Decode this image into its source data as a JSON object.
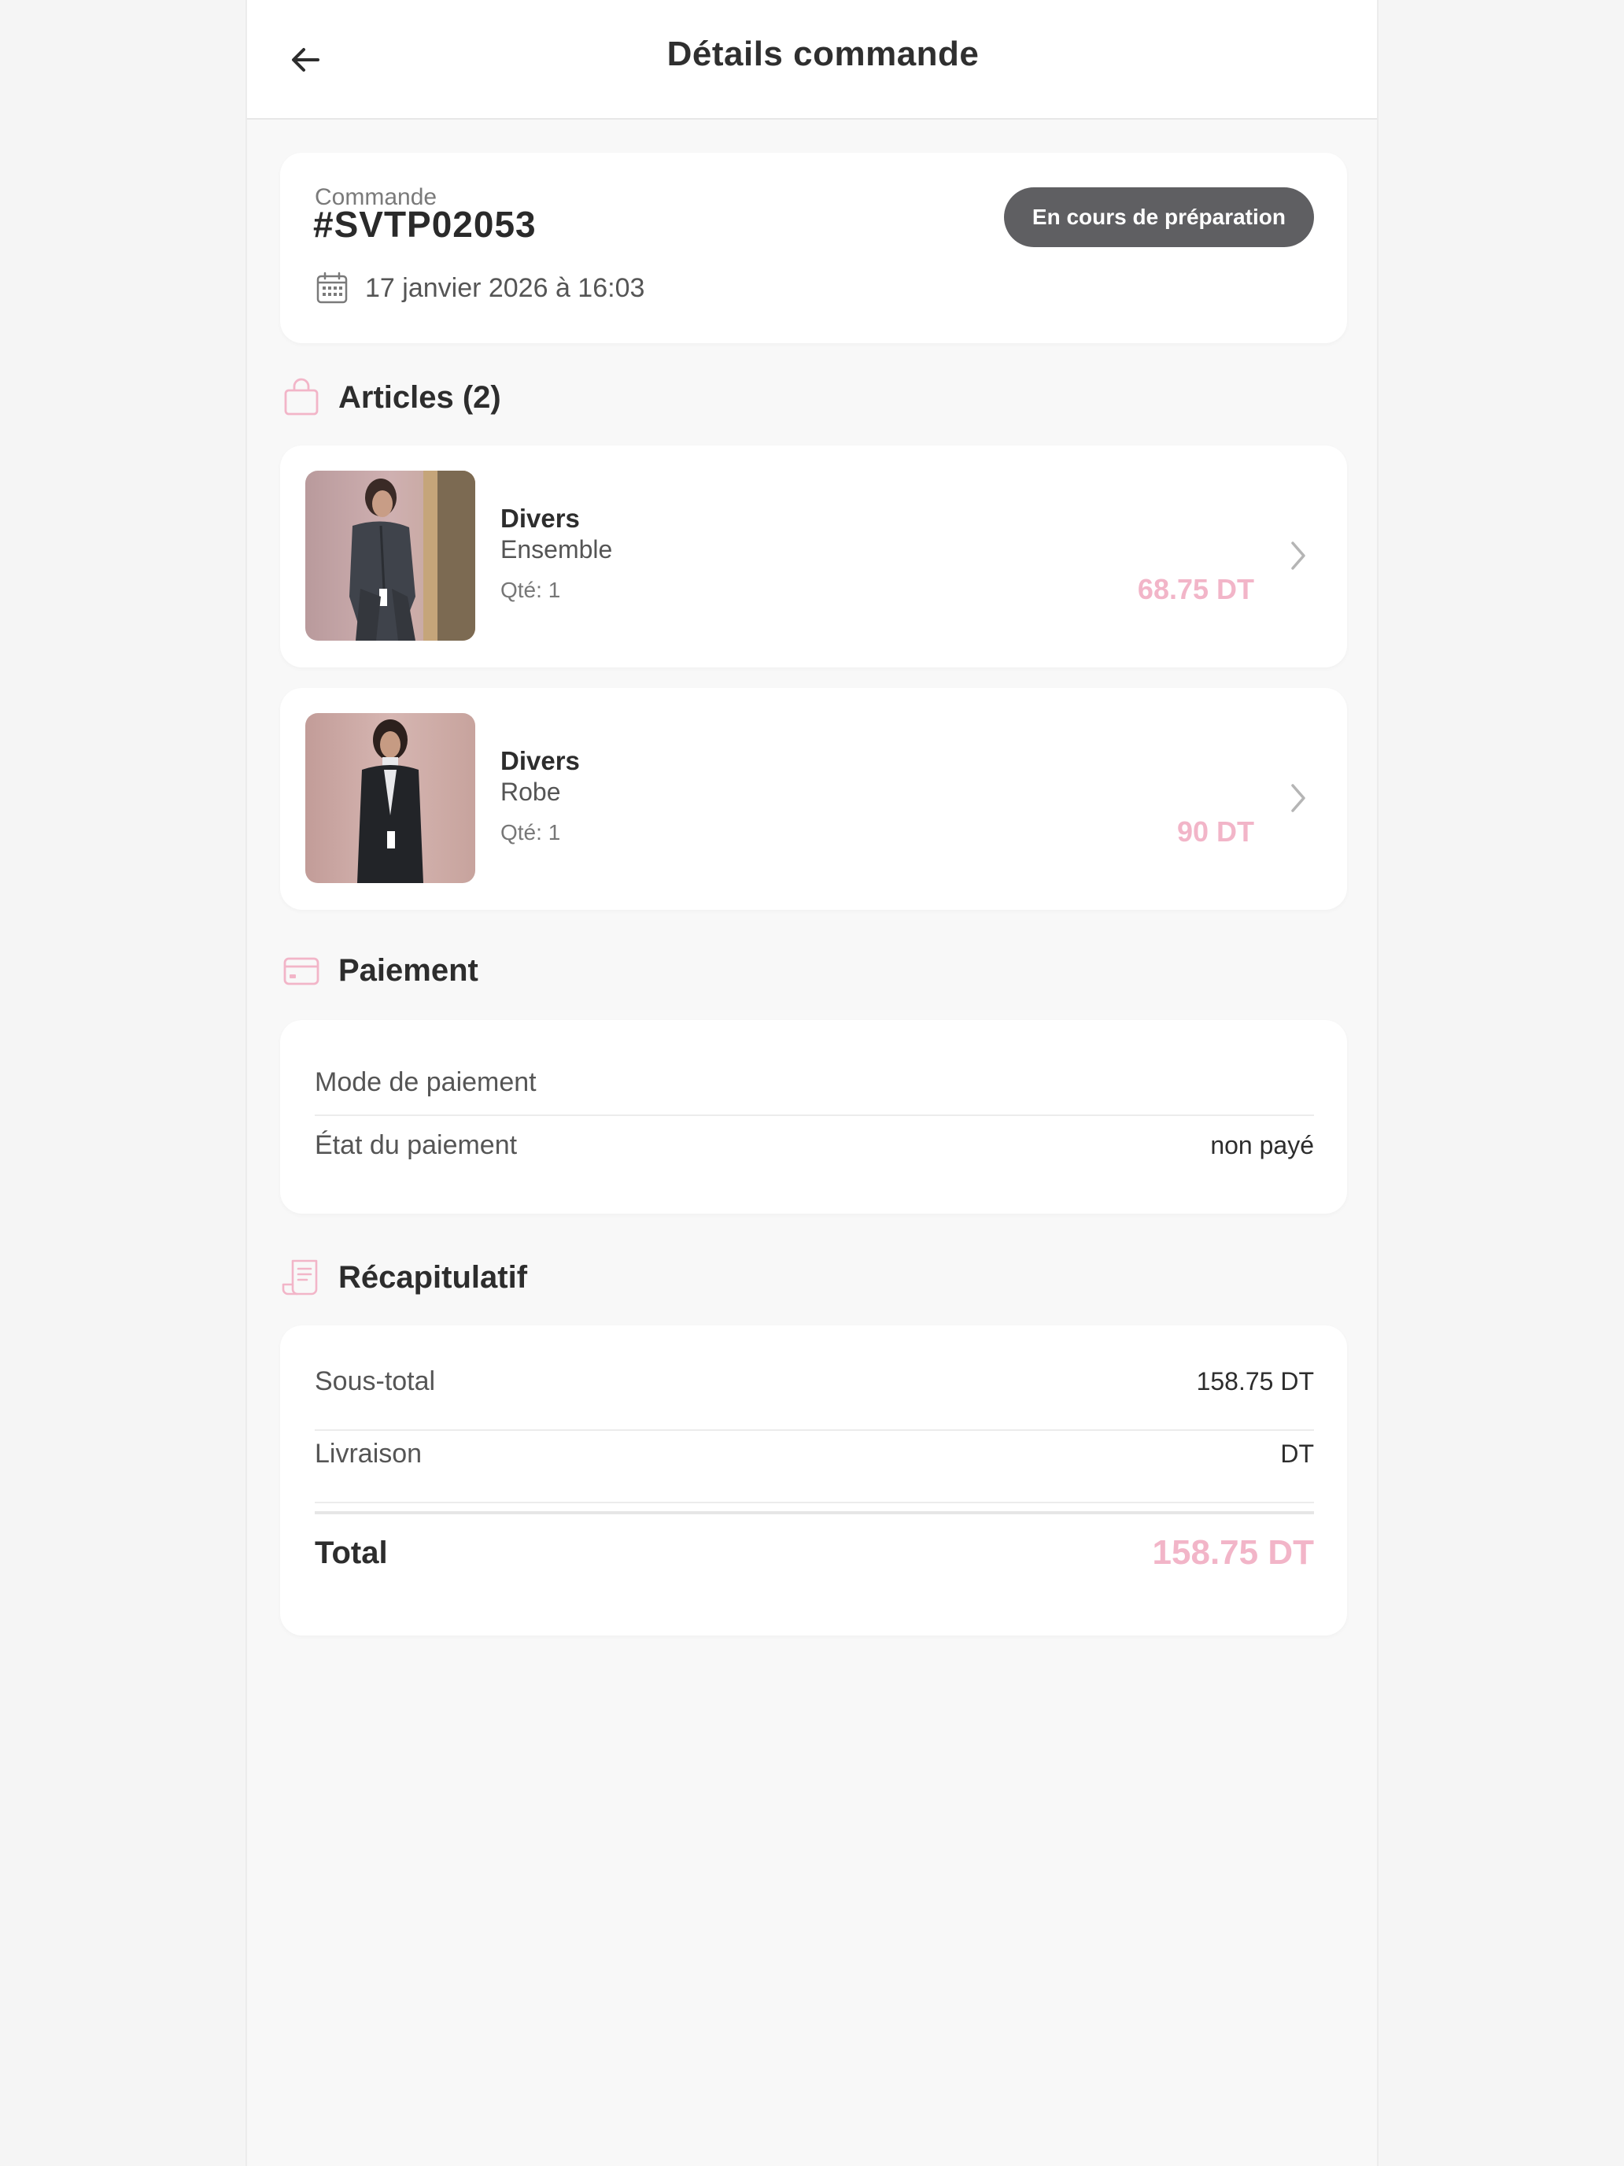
{
  "header": {
    "title": "Détails commande"
  },
  "order": {
    "label": "Commande",
    "number": "#SVTP02053",
    "status": "En cours de préparation",
    "date": "17 janvier 2026 à 16:03"
  },
  "articles": {
    "title": "Articles (2)",
    "items": [
      {
        "name": "Divers",
        "variant": "Ensemble",
        "qty": "Qté: 1",
        "price": "68.75 DT"
      },
      {
        "name": "Divers",
        "variant": "Robe",
        "qty": "Qté: 1",
        "price": "90 DT"
      }
    ]
  },
  "payment": {
    "title": "Paiement",
    "mode_label": "Mode de paiement",
    "mode_value": "",
    "status_label": "État du paiement",
    "status_value": "non payé"
  },
  "summary": {
    "title": "Récapitulatif",
    "subtotal_label": "Sous-total",
    "subtotal_value": "158.75 DT",
    "delivery_label": "Livraison",
    "delivery_value": "DT",
    "total_label": "Total",
    "total_value": "158.75 DT"
  },
  "colors": {
    "accent": "#f2b5c8",
    "badge": "#5f5f62",
    "background": "#f8f8f8"
  }
}
